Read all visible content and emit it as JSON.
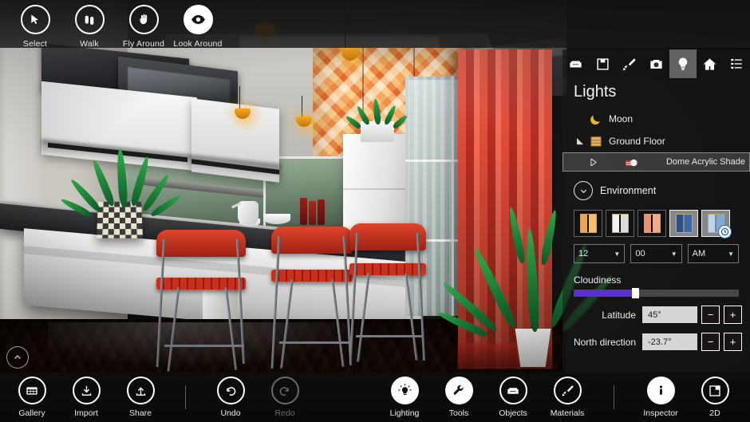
{
  "top_toolbar": {
    "tools": [
      {
        "label": "Select",
        "icon": "cursor-arrow-icon",
        "active": false
      },
      {
        "label": "Walk",
        "icon": "footprints-icon",
        "active": false
      },
      {
        "label": "Fly Around",
        "icon": "hand-icon",
        "active": false
      },
      {
        "label": "Look Around",
        "icon": "eye-icon",
        "active": true
      }
    ]
  },
  "panel": {
    "title": "Lights",
    "tabs": [
      {
        "icon": "sofa-furniture-icon",
        "name": "furniture",
        "active": false
      },
      {
        "icon": "floppy-save-icon",
        "name": "save",
        "active": false
      },
      {
        "icon": "paintbrush-icon",
        "name": "materials",
        "active": false
      },
      {
        "icon": "camera-icon",
        "name": "camera",
        "active": false
      },
      {
        "icon": "lightbulb-icon",
        "name": "lights",
        "active": true
      },
      {
        "icon": "home-icon",
        "name": "home",
        "active": false
      },
      {
        "icon": "list-icon",
        "name": "list",
        "active": false
      }
    ],
    "tree": [
      {
        "label": "Moon",
        "icon": "crescent-moon-icon",
        "indent": 0,
        "twisty": "none",
        "selected": false
      },
      {
        "label": "Ground Floor",
        "icon": "box-crate-icon",
        "indent": 0,
        "twisty": "expanded",
        "selected": false
      },
      {
        "label": "Dome Acrylic Shade",
        "icon": "dome-lamp-icon",
        "indent": 1,
        "twisty": "collapsed",
        "selected": true
      }
    ],
    "environment": {
      "label": "Environment",
      "toggle_icon": "chevron-down-circle-icon",
      "presets": [
        {
          "name": "warm-dusk-window",
          "selected": false,
          "left": "#f0a54a",
          "right": "#f7c06a",
          "clock": false
        },
        {
          "name": "daylight-window",
          "selected": false,
          "left": "#f2f2ee",
          "right": "#dcdcd4",
          "clock": false
        },
        {
          "name": "sunset-window",
          "selected": false,
          "left": "#ef8f74",
          "right": "#f3a88c",
          "clock": false
        },
        {
          "name": "night-window",
          "selected": true,
          "left": "#2c4f86",
          "right": "#3d67a5",
          "clock": false
        },
        {
          "name": "custom-time-window",
          "selected": true,
          "left": "#bcd4ec",
          "right": "#7fa8d4",
          "clock": true
        }
      ],
      "time": {
        "hour": "12",
        "minute": "00",
        "meridiem": "AM"
      },
      "cloudiness": {
        "label": "Cloudiness",
        "value": 36,
        "fill_color": "#5b2fd6"
      },
      "latitude": {
        "label": "Latitude",
        "value": "45°",
        "minus": "−",
        "plus": "+"
      },
      "north_direction": {
        "label": "North direction",
        "value": "-23.7°",
        "minus": "−",
        "plus": "+"
      }
    }
  },
  "bottom_toolbar": {
    "left_items": [
      {
        "label": "Gallery",
        "icon": "grid-gallery-icon",
        "dim": false
      },
      {
        "label": "Import",
        "icon": "download-import-icon",
        "dim": false
      },
      {
        "label": "Share",
        "icon": "upload-share-icon",
        "dim": false
      }
    ],
    "history_items": [
      {
        "label": "Undo",
        "icon": "undo-arrow-icon",
        "dim": false
      },
      {
        "label": "Redo",
        "icon": "redo-arrow-icon",
        "dim": true
      }
    ],
    "mode_items": [
      {
        "label": "Lighting",
        "icon": "lightbulb-rays-icon",
        "dim": false
      },
      {
        "label": "Tools",
        "icon": "wrench-icon",
        "dim": false
      },
      {
        "label": "Objects",
        "icon": "sofa-furniture-icon",
        "dim": false
      },
      {
        "label": "Materials",
        "icon": "paintbrush-icon",
        "dim": false
      }
    ],
    "right_items": [
      {
        "label": "Inspector",
        "icon": "info-circle-icon",
        "dim": false
      },
      {
        "label": "2D",
        "icon": "floorplan-2d-icon",
        "dim": false
      }
    ]
  },
  "viewport": {
    "collapse_icon": "chevron-up-circle-icon"
  }
}
